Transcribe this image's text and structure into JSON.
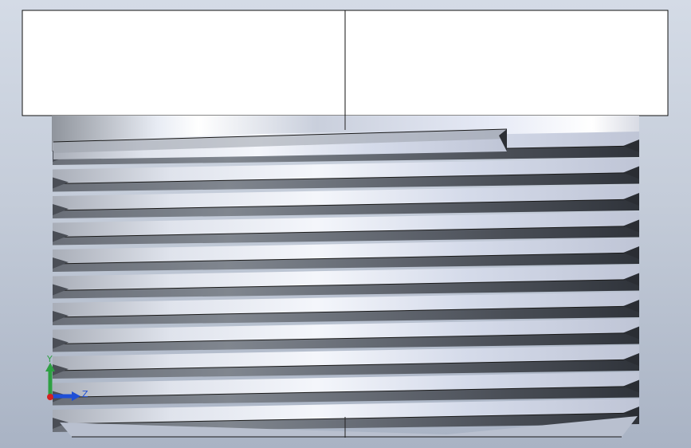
{
  "viewport": {
    "background_top": "#d4dbe6",
    "background_bottom": "#a9b3c4"
  },
  "model": {
    "part": "threaded-fitting",
    "thread_turns_visible": 11,
    "colors": {
      "shank_light": "#ffffff",
      "shank_mid": "#d3d9e8",
      "shank_dark": "#8f949c",
      "thread_dark": "#3a3e46",
      "edge": "#1a1a1a"
    }
  },
  "triad": {
    "y_label": "Y",
    "z_label": "Z",
    "y_color": "#2ea043",
    "z_color": "#1f4fd6",
    "x_color": "#d42020"
  }
}
